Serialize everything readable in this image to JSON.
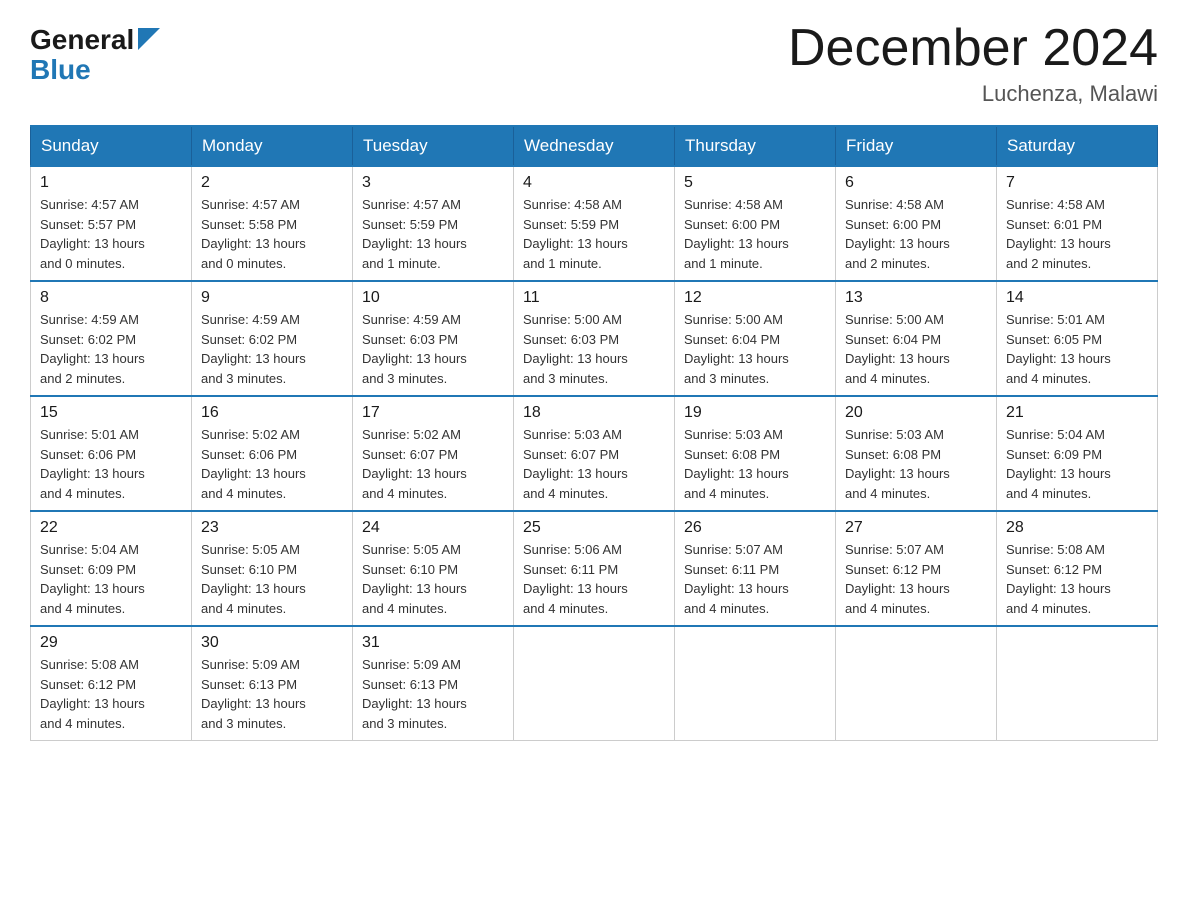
{
  "header": {
    "logo": {
      "text_general": "General",
      "text_blue": "Blue"
    },
    "title": "December 2024",
    "location": "Luchenza, Malawi"
  },
  "calendar": {
    "days_of_week": [
      "Sunday",
      "Monday",
      "Tuesday",
      "Wednesday",
      "Thursday",
      "Friday",
      "Saturday"
    ],
    "weeks": [
      [
        {
          "day": "1",
          "sunrise": "4:57 AM",
          "sunset": "5:57 PM",
          "daylight": "13 hours and 0 minutes."
        },
        {
          "day": "2",
          "sunrise": "4:57 AM",
          "sunset": "5:58 PM",
          "daylight": "13 hours and 0 minutes."
        },
        {
          "day": "3",
          "sunrise": "4:57 AM",
          "sunset": "5:59 PM",
          "daylight": "13 hours and 1 minute."
        },
        {
          "day": "4",
          "sunrise": "4:58 AM",
          "sunset": "5:59 PM",
          "daylight": "13 hours and 1 minute."
        },
        {
          "day": "5",
          "sunrise": "4:58 AM",
          "sunset": "6:00 PM",
          "daylight": "13 hours and 1 minute."
        },
        {
          "day": "6",
          "sunrise": "4:58 AM",
          "sunset": "6:00 PM",
          "daylight": "13 hours and 2 minutes."
        },
        {
          "day": "7",
          "sunrise": "4:58 AM",
          "sunset": "6:01 PM",
          "daylight": "13 hours and 2 minutes."
        }
      ],
      [
        {
          "day": "8",
          "sunrise": "4:59 AM",
          "sunset": "6:02 PM",
          "daylight": "13 hours and 2 minutes."
        },
        {
          "day": "9",
          "sunrise": "4:59 AM",
          "sunset": "6:02 PM",
          "daylight": "13 hours and 3 minutes."
        },
        {
          "day": "10",
          "sunrise": "4:59 AM",
          "sunset": "6:03 PM",
          "daylight": "13 hours and 3 minutes."
        },
        {
          "day": "11",
          "sunrise": "5:00 AM",
          "sunset": "6:03 PM",
          "daylight": "13 hours and 3 minutes."
        },
        {
          "day": "12",
          "sunrise": "5:00 AM",
          "sunset": "6:04 PM",
          "daylight": "13 hours and 3 minutes."
        },
        {
          "day": "13",
          "sunrise": "5:00 AM",
          "sunset": "6:04 PM",
          "daylight": "13 hours and 4 minutes."
        },
        {
          "day": "14",
          "sunrise": "5:01 AM",
          "sunset": "6:05 PM",
          "daylight": "13 hours and 4 minutes."
        }
      ],
      [
        {
          "day": "15",
          "sunrise": "5:01 AM",
          "sunset": "6:06 PM",
          "daylight": "13 hours and 4 minutes."
        },
        {
          "day": "16",
          "sunrise": "5:02 AM",
          "sunset": "6:06 PM",
          "daylight": "13 hours and 4 minutes."
        },
        {
          "day": "17",
          "sunrise": "5:02 AM",
          "sunset": "6:07 PM",
          "daylight": "13 hours and 4 minutes."
        },
        {
          "day": "18",
          "sunrise": "5:03 AM",
          "sunset": "6:07 PM",
          "daylight": "13 hours and 4 minutes."
        },
        {
          "day": "19",
          "sunrise": "5:03 AM",
          "sunset": "6:08 PM",
          "daylight": "13 hours and 4 minutes."
        },
        {
          "day": "20",
          "sunrise": "5:03 AM",
          "sunset": "6:08 PM",
          "daylight": "13 hours and 4 minutes."
        },
        {
          "day": "21",
          "sunrise": "5:04 AM",
          "sunset": "6:09 PM",
          "daylight": "13 hours and 4 minutes."
        }
      ],
      [
        {
          "day": "22",
          "sunrise": "5:04 AM",
          "sunset": "6:09 PM",
          "daylight": "13 hours and 4 minutes."
        },
        {
          "day": "23",
          "sunrise": "5:05 AM",
          "sunset": "6:10 PM",
          "daylight": "13 hours and 4 minutes."
        },
        {
          "day": "24",
          "sunrise": "5:05 AM",
          "sunset": "6:10 PM",
          "daylight": "13 hours and 4 minutes."
        },
        {
          "day": "25",
          "sunrise": "5:06 AM",
          "sunset": "6:11 PM",
          "daylight": "13 hours and 4 minutes."
        },
        {
          "day": "26",
          "sunrise": "5:07 AM",
          "sunset": "6:11 PM",
          "daylight": "13 hours and 4 minutes."
        },
        {
          "day": "27",
          "sunrise": "5:07 AM",
          "sunset": "6:12 PM",
          "daylight": "13 hours and 4 minutes."
        },
        {
          "day": "28",
          "sunrise": "5:08 AM",
          "sunset": "6:12 PM",
          "daylight": "13 hours and 4 minutes."
        }
      ],
      [
        {
          "day": "29",
          "sunrise": "5:08 AM",
          "sunset": "6:12 PM",
          "daylight": "13 hours and 4 minutes."
        },
        {
          "day": "30",
          "sunrise": "5:09 AM",
          "sunset": "6:13 PM",
          "daylight": "13 hours and 3 minutes."
        },
        {
          "day": "31",
          "sunrise": "5:09 AM",
          "sunset": "6:13 PM",
          "daylight": "13 hours and 3 minutes."
        },
        null,
        null,
        null,
        null
      ]
    ],
    "labels": {
      "sunrise": "Sunrise:",
      "sunset": "Sunset:",
      "daylight": "Daylight:"
    }
  }
}
